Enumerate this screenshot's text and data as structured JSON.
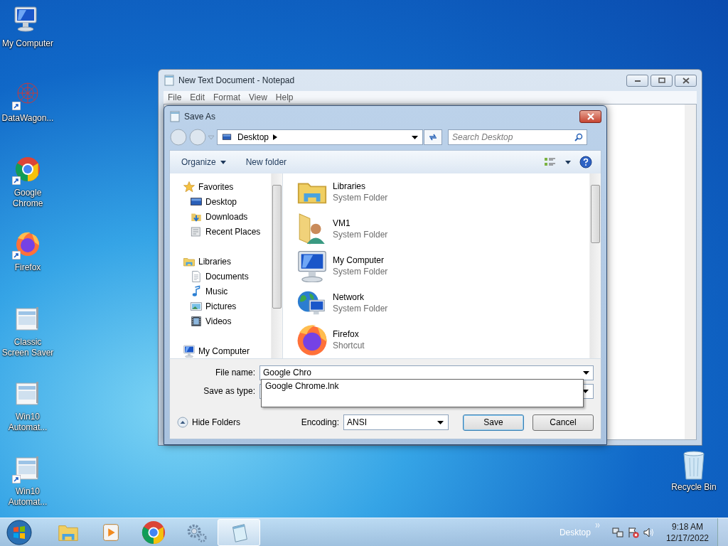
{
  "desktop_icons": [
    {
      "label": "My Computer",
      "kind": "computer",
      "shortcut": false
    },
    {
      "label": "DataWagon...",
      "kind": "web",
      "shortcut": true
    },
    {
      "label": "Google Chrome",
      "kind": "chrome",
      "shortcut": true
    },
    {
      "label": "Firefox",
      "kind": "firefox",
      "shortcut": true
    },
    {
      "label": "Classic Screen Saver",
      "kind": "installer",
      "shortcut": false
    },
    {
      "label": "Win10 Automat...",
      "kind": "installer",
      "shortcut": false
    },
    {
      "label": "Win10 Automat...",
      "kind": "installer",
      "shortcut": true
    }
  ],
  "recycle_bin": {
    "label": "Recycle Bin"
  },
  "notepad": {
    "title": "New Text Document - Notepad",
    "menu": [
      "File",
      "Edit",
      "Format",
      "View",
      "Help"
    ]
  },
  "save_dialog": {
    "title": "Save As",
    "address": "Desktop",
    "search": {
      "placeholder": "Search Desktop"
    },
    "toolbar": [
      {
        "label": "Organize",
        "dropdown": true
      },
      {
        "label": "New folder",
        "dropdown": false
      }
    ],
    "nav": [
      {
        "label": "Favorites",
        "kind": "star",
        "children": [
          {
            "label": "Desktop",
            "kind": "desktop"
          },
          {
            "label": "Downloads",
            "kind": "downloads"
          },
          {
            "label": "Recent Places",
            "kind": "recent"
          }
        ]
      },
      {
        "label": "Libraries",
        "kind": "libraries",
        "children": [
          {
            "label": "Documents",
            "kind": "document"
          },
          {
            "label": "Music",
            "kind": "music"
          },
          {
            "label": "Pictures",
            "kind": "pictures"
          },
          {
            "label": "Videos",
            "kind": "videos"
          }
        ]
      },
      {
        "label": "My Computer",
        "kind": "computer"
      }
    ],
    "files": [
      {
        "name": "Libraries",
        "type": "System Folder",
        "kind": "libraries"
      },
      {
        "name": "VM1",
        "type": "System Folder",
        "kind": "userfolder"
      },
      {
        "name": "My Computer",
        "type": "System Folder",
        "kind": "computer"
      },
      {
        "name": "Network",
        "type": "System Folder",
        "kind": "network"
      },
      {
        "name": "Firefox",
        "type": "Shortcut",
        "kind": "firefox"
      }
    ],
    "file_name": {
      "label": "File name:",
      "value": "Google Chro"
    },
    "autocomplete": [
      "Google Chrome.lnk"
    ],
    "save_as_type": {
      "label": "Save as type:"
    },
    "hide_folders": "Hide Folders",
    "encoding": {
      "label": "Encoding:",
      "value": "ANSI"
    },
    "buttons": [
      {
        "label": "Save",
        "default": true
      },
      {
        "label": "Cancel",
        "default": false
      }
    ]
  },
  "taskbar": {
    "items": [
      {
        "kind": "explorer",
        "selected": false
      },
      {
        "kind": "media",
        "selected": false
      },
      {
        "kind": "chrome",
        "selected": false
      },
      {
        "kind": "gear",
        "selected": false
      },
      {
        "kind": "notepad",
        "selected": true
      }
    ],
    "desktop": "Desktop",
    "time": "9:18 AM",
    "date": "12/17/2022"
  }
}
